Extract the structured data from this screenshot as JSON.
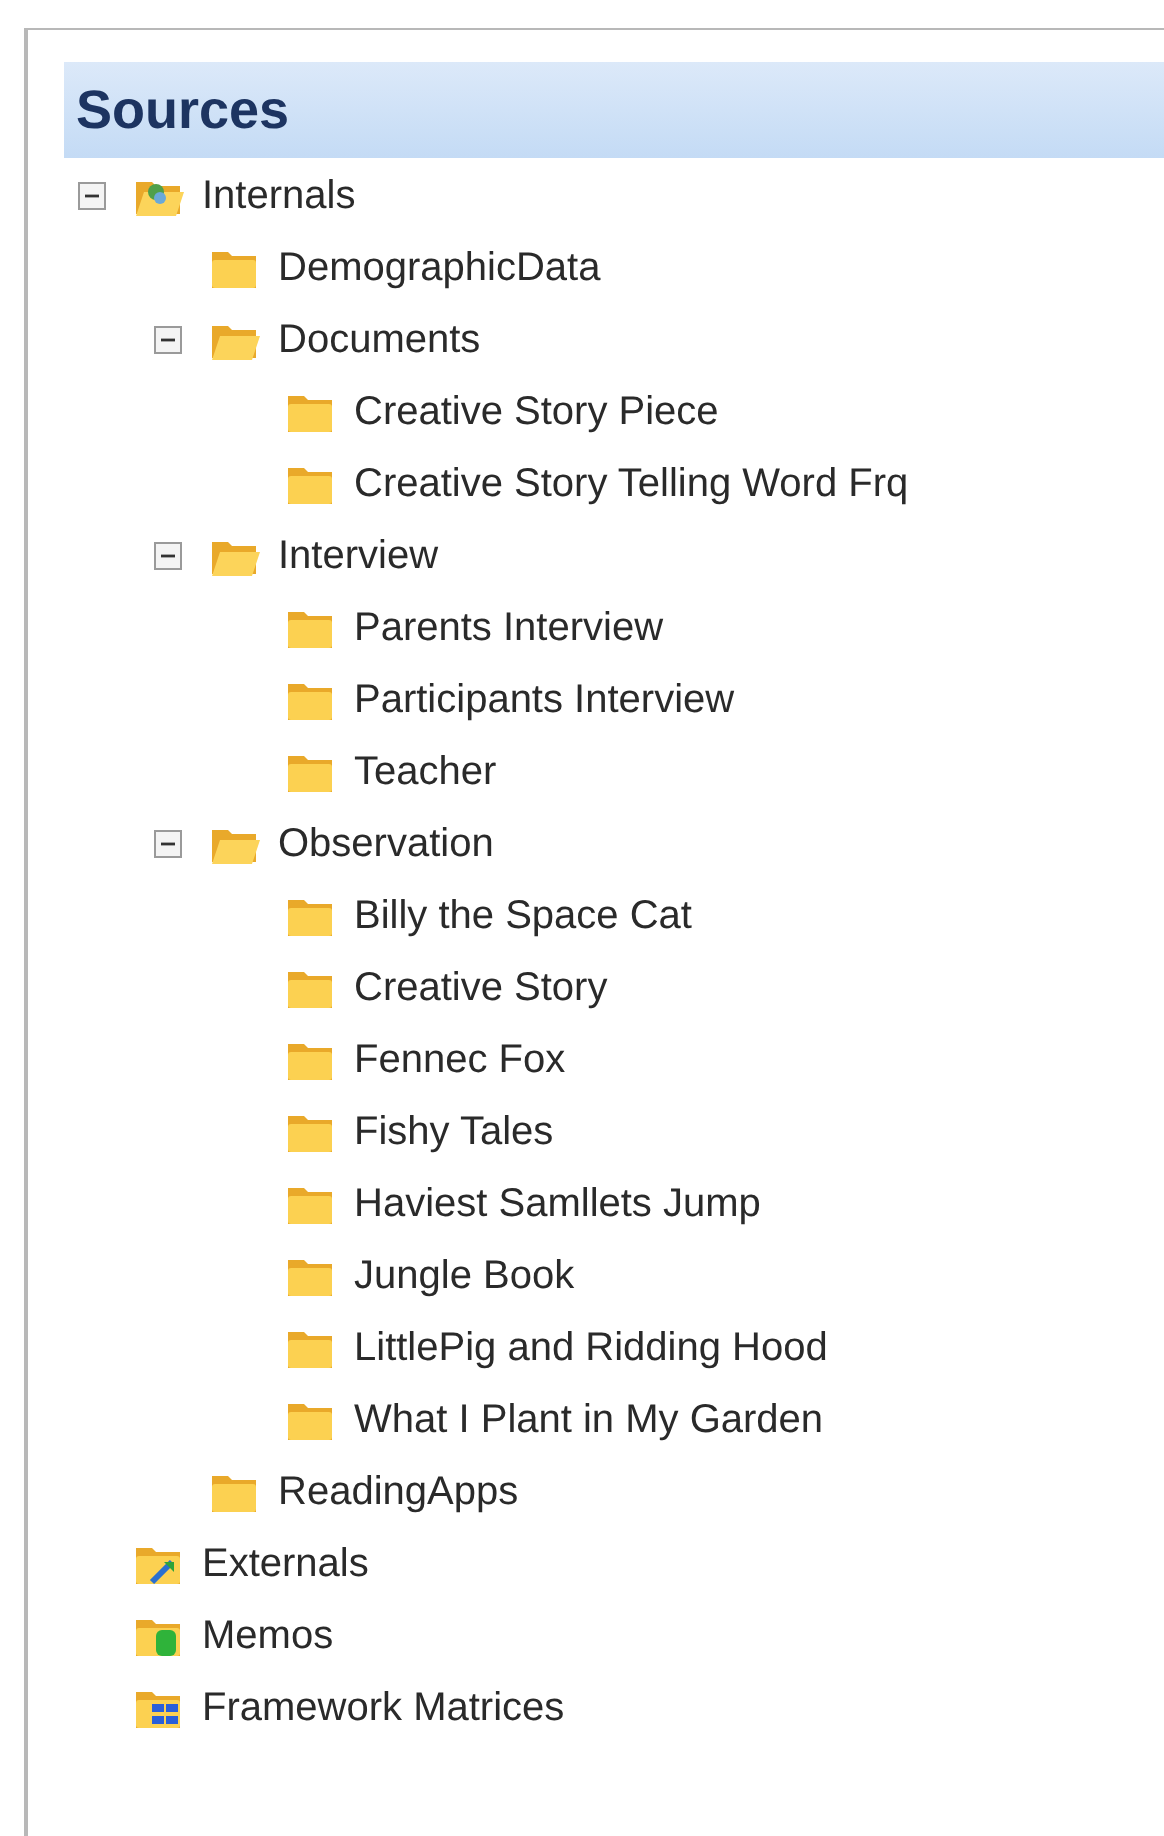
{
  "panel": {
    "title": "Sources"
  },
  "tree": [
    {
      "label": "Internals",
      "kind": "internals",
      "expanded": true,
      "children": [
        {
          "label": "DemographicData",
          "kind": "folder"
        },
        {
          "label": "Documents",
          "kind": "folder",
          "expanded": true,
          "children": [
            {
              "label": "Creative Story Piece",
              "kind": "folder"
            },
            {
              "label": "Creative Story Telling Word Frq",
              "kind": "folder"
            }
          ]
        },
        {
          "label": "Interview",
          "kind": "folder",
          "expanded": true,
          "children": [
            {
              "label": "Parents Interview",
              "kind": "folder"
            },
            {
              "label": "Participants Interview",
              "kind": "folder"
            },
            {
              "label": "Teacher",
              "kind": "folder"
            }
          ]
        },
        {
          "label": "Observation",
          "kind": "folder",
          "expanded": true,
          "children": [
            {
              "label": "Billy the Space Cat",
              "kind": "folder"
            },
            {
              "label": "Creative Story",
              "kind": "folder"
            },
            {
              "label": "Fennec Fox",
              "kind": "folder"
            },
            {
              "label": "Fishy Tales",
              "kind": "folder"
            },
            {
              "label": "Haviest Samllets Jump",
              "kind": "folder"
            },
            {
              "label": "Jungle Book",
              "kind": "folder"
            },
            {
              "label": "LittlePig and Ridding Hood",
              "kind": "folder"
            },
            {
              "label": "What I Plant in My Garden",
              "kind": "folder"
            }
          ]
        },
        {
          "label": "ReadingApps",
          "kind": "folder"
        }
      ]
    },
    {
      "label": "Externals",
      "kind": "externals"
    },
    {
      "label": "Memos",
      "kind": "memos"
    },
    {
      "label": "Framework Matrices",
      "kind": "matrices"
    }
  ]
}
